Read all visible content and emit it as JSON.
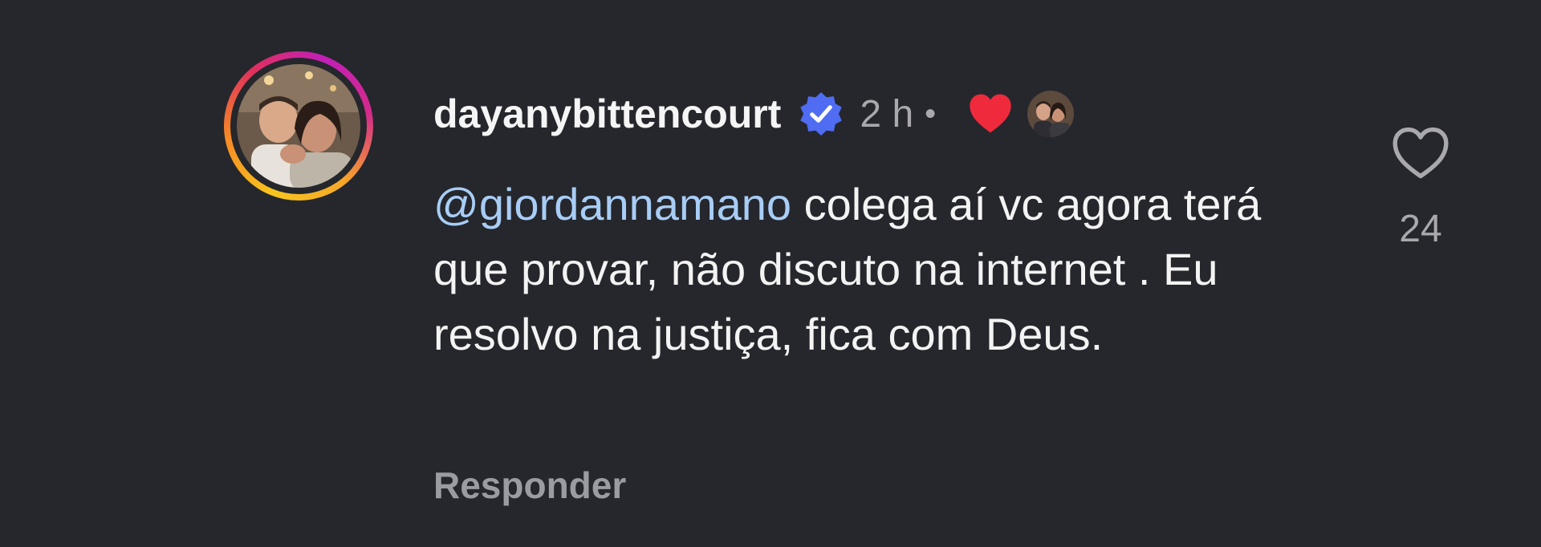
{
  "comment": {
    "username": "dayanybittencourt",
    "verified": true,
    "time": "2 h",
    "separator": "•",
    "mention": "@giordannamano",
    "text_after_mention": " colega aí vc agora terá que provar, não discuto na internet . Eu resolvo na justiça, fica com Deus.",
    "reply_label": "Responder",
    "like_count": "24",
    "creator_liked": true
  },
  "colors": {
    "background": "#25272c",
    "mention": "#a8cdf6",
    "verified_badge": "#4f6cf2",
    "heart_red": "#ef2a3c",
    "muted": "#a8a8ad"
  },
  "icons": {
    "verified": "verified-badge-icon",
    "creator_heart": "heart-filled-icon",
    "like": "heart-outline-icon"
  }
}
